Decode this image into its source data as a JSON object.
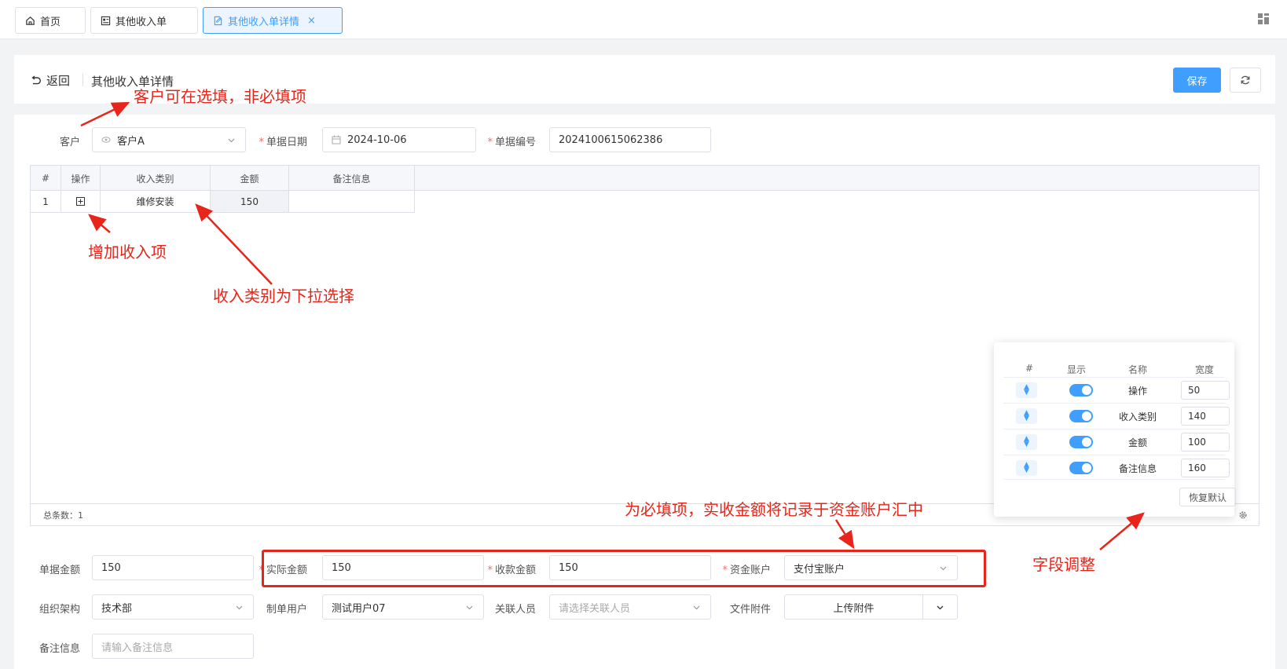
{
  "tabs": [
    {
      "label": "首页",
      "icon": "home-icon"
    },
    {
      "label": "其他收入单",
      "icon": "list-icon"
    },
    {
      "label": "其他收入单详情",
      "icon": "edit-doc-icon",
      "active": true,
      "close": "×"
    }
  ],
  "header": {
    "back_label": "返回",
    "title": "其他收入单详情",
    "save_label": "保存"
  },
  "form": {
    "customer": {
      "label": "客户",
      "value": "客户A"
    },
    "date": {
      "label": "单据日期",
      "value": "2024-10-06",
      "required": "*"
    },
    "number": {
      "label": "单据编号",
      "value": "2024100615062386",
      "required": "*"
    },
    "bill_amount": {
      "label": "单据金额",
      "value": "150"
    },
    "actual_amount": {
      "label": "实际金额",
      "value": "150",
      "required": "*"
    },
    "received_amount": {
      "label": "收款金额",
      "value": "150",
      "required": "*"
    },
    "fund_account": {
      "label": "资金账户",
      "value": "支付宝账户",
      "required": "*"
    },
    "org": {
      "label": "组织架构",
      "value": "技术部"
    },
    "creator": {
      "label": "制单用户",
      "value": "测试用户07"
    },
    "related": {
      "label": "关联人员",
      "placeholder": "请选择关联人员"
    },
    "attachment": {
      "label": "文件附件",
      "button": "上传附件"
    },
    "remark": {
      "label": "备注信息",
      "placeholder": "请输入备注信息"
    }
  },
  "table": {
    "headers": [
      "#",
      "操作",
      "收入类别",
      "金额",
      "备注信息"
    ],
    "rows": [
      {
        "index": "1",
        "category": "维修安装",
        "amount": "150",
        "remark": ""
      }
    ],
    "footer": "总条数：1"
  },
  "field_settings": {
    "headers": [
      "#",
      "显示",
      "名称",
      "宽度"
    ],
    "rows": [
      {
        "name": "操作",
        "width": "50",
        "visible": true
      },
      {
        "name": "收入类别",
        "width": "140",
        "visible": true
      },
      {
        "name": "金额",
        "width": "100",
        "visible": true
      },
      {
        "name": "备注信息",
        "width": "160",
        "visible": true
      }
    ],
    "restore_label": "恢复默认"
  },
  "annotations": {
    "customer_note": "客户可在选填，非必填项",
    "add_item_note": "增加收入项",
    "category_note": "收入类别为下拉选择",
    "required_note": "为必填项，实收金额将记录于资金账户汇中",
    "field_adjust_note": "字段调整"
  },
  "colors": {
    "accent": "#409eff",
    "annotation": "#e8251a"
  }
}
